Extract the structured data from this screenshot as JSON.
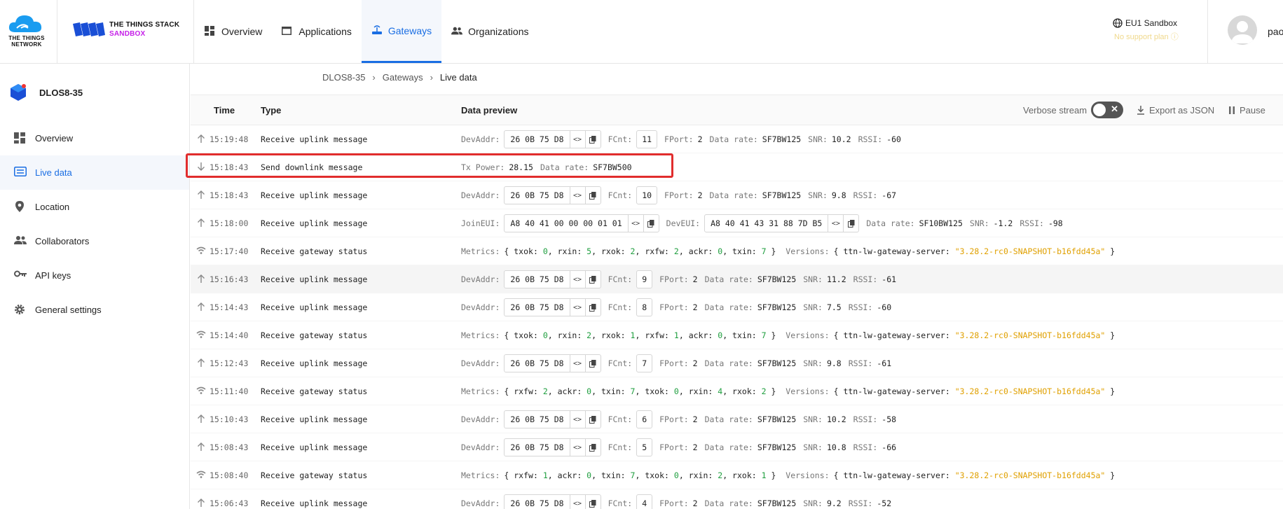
{
  "brand": {
    "ttn_text_line1": "THE THINGS",
    "ttn_text_line2": "NETWORK",
    "stack_line1": "THE THINGS STACK",
    "stack_line2": "SANDBOX"
  },
  "nav": {
    "items": [
      {
        "label": "Overview",
        "icon": "dashboard-icon"
      },
      {
        "label": "Applications",
        "icon": "window-icon"
      },
      {
        "label": "Gateways",
        "icon": "router-icon"
      },
      {
        "label": "Organizations",
        "icon": "people-icon"
      }
    ],
    "active": "Gateways"
  },
  "cluster": {
    "name": "EU1 Sandbox",
    "support": "No support plan"
  },
  "user": {
    "name": "pao"
  },
  "sidebar": {
    "gateway_name": "DLOS8-35",
    "items": [
      {
        "label": "Overview",
        "icon": "dashboard-icon"
      },
      {
        "label": "Live data",
        "icon": "list-icon"
      },
      {
        "label": "Location",
        "icon": "pin-icon"
      },
      {
        "label": "Collaborators",
        "icon": "people-icon"
      },
      {
        "label": "API keys",
        "icon": "key-icon"
      },
      {
        "label": "General settings",
        "icon": "gear-icon"
      }
    ],
    "active": "Live data"
  },
  "breadcrumb": [
    "DLOS8-35",
    "Gateways",
    "Live data"
  ],
  "table": {
    "headers": {
      "time": "Time",
      "type": "Type",
      "preview": "Data preview"
    },
    "verbose_label": "Verbose stream",
    "verbose_on": false,
    "export_label": "Export as JSON",
    "pause_label": "Pause",
    "rows": [
      {
        "time": "15:19:48",
        "type": "Receive uplink message",
        "kind": "uplink",
        "devaddr": "26 0B 75 D8",
        "fcnt": "11",
        "fport": "2",
        "datarate": "SF7BW125",
        "snr": "10.2",
        "rssi": "-60"
      },
      {
        "time": "15:18:43",
        "type": "Send downlink message",
        "kind": "downlink",
        "txpower": "28.15",
        "datarate": "SF7BW500"
      },
      {
        "time": "15:18:43",
        "type": "Receive uplink message",
        "kind": "uplink",
        "devaddr": "26 0B 75 D8",
        "fcnt": "10",
        "fport": "2",
        "datarate": "SF7BW125",
        "snr": "9.8",
        "rssi": "-67"
      },
      {
        "time": "15:18:00",
        "type": "Receive uplink message",
        "kind": "join",
        "joineui": "A8 40 41 00 00 00 01 01",
        "deveui": "A8 40 41 43 31 88 7D B5",
        "datarate": "SF10BW125",
        "snr": "-1.2",
        "rssi": "-98"
      },
      {
        "time": "15:17:40",
        "type": "Receive gateway status",
        "kind": "status",
        "metrics": [
          [
            "txok",
            "0"
          ],
          [
            "rxin",
            "5"
          ],
          [
            "rxok",
            "2"
          ],
          [
            "rxfw",
            "2"
          ],
          [
            "ackr",
            "0"
          ],
          [
            "txin",
            "7"
          ]
        ],
        "version_key": "ttn-lw-gateway-server",
        "version_val": "\"3.28.2-rc0-SNAPSHOT-b16fdd45a\""
      },
      {
        "time": "15:16:43",
        "type": "Receive uplink message",
        "kind": "uplink",
        "alt": true,
        "devaddr": "26 0B 75 D8",
        "fcnt": "9",
        "fport": "2",
        "datarate": "SF7BW125",
        "snr": "11.2",
        "rssi": "-61"
      },
      {
        "time": "15:14:43",
        "type": "Receive uplink message",
        "kind": "uplink",
        "devaddr": "26 0B 75 D8",
        "fcnt": "8",
        "fport": "2",
        "datarate": "SF7BW125",
        "snr": "7.5",
        "rssi": "-60"
      },
      {
        "time": "15:14:40",
        "type": "Receive gateway status",
        "kind": "status",
        "metrics": [
          [
            "txok",
            "0"
          ],
          [
            "rxin",
            "2"
          ],
          [
            "rxok",
            "1"
          ],
          [
            "rxfw",
            "1"
          ],
          [
            "ackr",
            "0"
          ],
          [
            "txin",
            "7"
          ]
        ],
        "version_key": "ttn-lw-gateway-server",
        "version_val": "\"3.28.2-rc0-SNAPSHOT-b16fdd45a\""
      },
      {
        "time": "15:12:43",
        "type": "Receive uplink message",
        "kind": "uplink",
        "devaddr": "26 0B 75 D8",
        "fcnt": "7",
        "fport": "2",
        "datarate": "SF7BW125",
        "snr": "9.8",
        "rssi": "-61"
      },
      {
        "time": "15:11:40",
        "type": "Receive gateway status",
        "kind": "status",
        "metrics": [
          [
            "rxfw",
            "2"
          ],
          [
            "ackr",
            "0"
          ],
          [
            "txin",
            "7"
          ],
          [
            "txok",
            "0"
          ],
          [
            "rxin",
            "4"
          ],
          [
            "rxok",
            "2"
          ]
        ],
        "version_key": "ttn-lw-gateway-server",
        "version_val": "\"3.28.2-rc0-SNAPSHOT-b16fdd45a\""
      },
      {
        "time": "15:10:43",
        "type": "Receive uplink message",
        "kind": "uplink",
        "devaddr": "26 0B 75 D8",
        "fcnt": "6",
        "fport": "2",
        "datarate": "SF7BW125",
        "snr": "10.2",
        "rssi": "-58"
      },
      {
        "time": "15:08:43",
        "type": "Receive uplink message",
        "kind": "uplink",
        "devaddr": "26 0B 75 D8",
        "fcnt": "5",
        "fport": "2",
        "datarate": "SF7BW125",
        "snr": "10.8",
        "rssi": "-66"
      },
      {
        "time": "15:08:40",
        "type": "Receive gateway status",
        "kind": "status",
        "metrics": [
          [
            "rxfw",
            "1"
          ],
          [
            "ackr",
            "0"
          ],
          [
            "txin",
            "7"
          ],
          [
            "txok",
            "0"
          ],
          [
            "rxin",
            "2"
          ],
          [
            "rxok",
            "1"
          ]
        ],
        "version_key": "ttn-lw-gateway-server",
        "version_val": "\"3.28.2-rc0-SNAPSHOT-b16fdd45a\""
      },
      {
        "time": "15:06:43",
        "type": "Receive uplink message",
        "kind": "uplink",
        "devaddr": "26 0B 75 D8",
        "fcnt": "4",
        "fport": "2",
        "datarate": "SF7BW125",
        "snr": "9.2",
        "rssi": "-52"
      }
    ]
  },
  "labels": {
    "devaddr": "DevAddr:",
    "fcnt": "FCnt:",
    "fport": "FPort:",
    "datarate": "Data rate:",
    "snr": "SNR:",
    "rssi": "RSSI:",
    "txpower": "Tx Power:",
    "joineui": "JoinEUI:",
    "deveui": "DevEUI:",
    "metrics": "Metrics:",
    "versions": "Versions:"
  },
  "colors": {
    "accent": "#1a6ee3",
    "highlight": "#e12d2d",
    "number": "#1e9e3e",
    "string": "#e0a000"
  }
}
